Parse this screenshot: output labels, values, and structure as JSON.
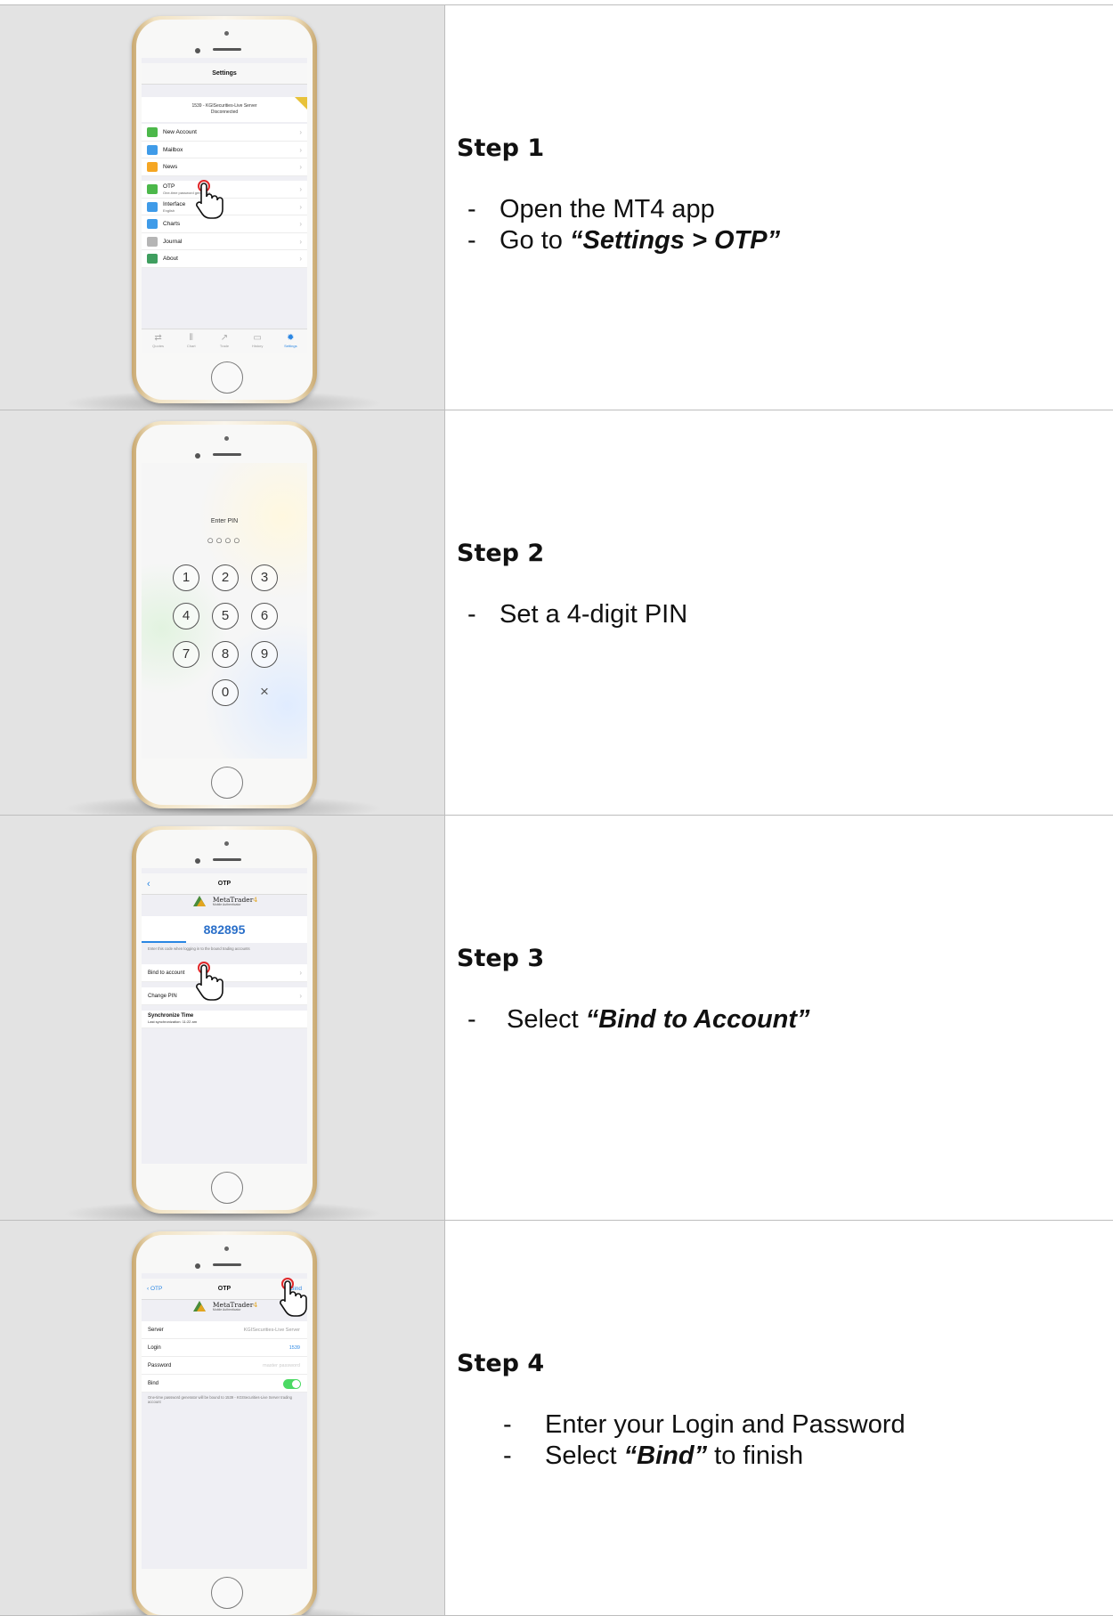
{
  "steps": [
    {
      "title": "Step 1",
      "lines": [
        {
          "dash": "-",
          "text": "Open the MT4 app",
          "quote": "",
          "suffix": ""
        },
        {
          "dash": "-",
          "text": "Go to ",
          "quote": "“Settings > OTP”",
          "suffix": ""
        }
      ],
      "screen": {
        "title": "Settings",
        "server_line1": "1539 - KGISecurities-Live Server",
        "server_line2": "Disconnected",
        "group1": [
          {
            "label": "New Account",
            "icon": "new-account-icon",
            "color": "#4cb84a"
          },
          {
            "label": "Mailbox",
            "icon": "mailbox-icon",
            "color": "#3f9be8"
          },
          {
            "label": "News",
            "icon": "news-icon",
            "color": "#f5a623"
          }
        ],
        "group2": [
          {
            "label": "OTP",
            "sub": "One-time password generator",
            "icon": "otp-icon",
            "color": "#4cb84a"
          },
          {
            "label": "Interface",
            "sub": "English",
            "icon": "interface-icon",
            "color": "#3f9be8"
          },
          {
            "label": "Charts",
            "sub": "",
            "icon": "charts-icon",
            "color": "#3f9be8"
          },
          {
            "label": "Journal",
            "sub": "",
            "icon": "journal-icon",
            "color": "#b5b5b5"
          },
          {
            "label": "About",
            "sub": "",
            "icon": "about-icon",
            "color": "#3f9e5f"
          }
        ],
        "tabs": [
          {
            "label": "Quotes",
            "icon": "quotes-icon",
            "glyph": "⇄"
          },
          {
            "label": "Chart",
            "icon": "chart-icon",
            "glyph": "⫴"
          },
          {
            "label": "Trade",
            "icon": "trade-icon",
            "glyph": "↗"
          },
          {
            "label": "History",
            "icon": "history-icon",
            "glyph": "▭"
          },
          {
            "label": "Settings",
            "icon": "settings-icon",
            "glyph": "✹"
          }
        ]
      }
    },
    {
      "title": "Step 2",
      "lines": [
        {
          "dash": "-",
          "text": "Set a 4-digit PIN",
          "quote": "",
          "suffix": ""
        }
      ],
      "screen": {
        "label": "Enter PIN",
        "dots": "○○○○",
        "keys": [
          "1",
          "2",
          "3",
          "4",
          "5",
          "6",
          "7",
          "8",
          "9",
          "0"
        ],
        "delete": "×"
      }
    },
    {
      "title": "Step 3",
      "lines": [
        {
          "dash": "-",
          "text": " Select ",
          "quote": "“Bind to Account”",
          "suffix": ""
        }
      ],
      "screen": {
        "title": "OTP",
        "back": "‹",
        "brand": "MetaTrader",
        "brand_num": "4",
        "brand_sub": "Mobile Authenticator",
        "code": "882895",
        "note": "Enter this code when logging in to the bound trading accounts",
        "items": [
          "Bind to account",
          "Change PIN"
        ],
        "sync_title": "Synchronize Time",
        "sync_sub": "Last synchronization: 11:22 am"
      }
    },
    {
      "title": "Step 4",
      "lines": [
        {
          "dash": "-",
          "text": "Enter your Login and Password",
          "quote": "",
          "suffix": ""
        },
        {
          "dash": "-",
          "text": "Select ",
          "quote": "“Bind”",
          "suffix": " to finish"
        }
      ],
      "screen": {
        "title": "OTP",
        "back": "‹ OTP",
        "action": "Bind",
        "brand": "MetaTrader",
        "brand_num": "4",
        "brand_sub": "Mobile Authenticator",
        "fields": [
          {
            "label": "Server",
            "value": "KGISecurities-Live Server"
          },
          {
            "label": "Login",
            "value": "1539"
          },
          {
            "label": "Password",
            "value": "master password"
          },
          {
            "label": "Bind",
            "value": ""
          }
        ],
        "note": "One-time password generator will be bound to 1539 - KGISecurities-Live Server trading account"
      }
    }
  ],
  "colors": {
    "accent": "#2a86e3",
    "toggle": "#4cd964",
    "gold": "#e8c23a",
    "cell_bg": "#e3e3e3"
  }
}
